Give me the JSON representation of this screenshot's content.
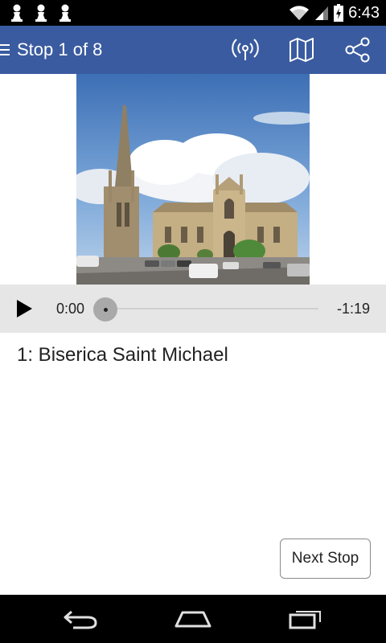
{
  "status_bar": {
    "time": "6:43",
    "notification_icons": [
      "pawn-icon",
      "pawn-icon",
      "pawn-icon"
    ],
    "indicators": [
      "wifi-icon",
      "signal-icon",
      "battery-charging-icon"
    ]
  },
  "app_bar": {
    "title": "Stop 1 of 8",
    "actions": [
      "broadcast-icon",
      "map-icon",
      "share-icon"
    ],
    "color": "#3a5ba0"
  },
  "stop": {
    "image_subject": "Saint Michael basilica",
    "title": "1: Biserica Saint Michael"
  },
  "player": {
    "elapsed": "0:00",
    "remaining": "-1:19",
    "progress": 0
  },
  "footer": {
    "next_label": "Next Stop"
  },
  "nav_bar": [
    "back-icon",
    "home-icon",
    "recents-icon"
  ]
}
